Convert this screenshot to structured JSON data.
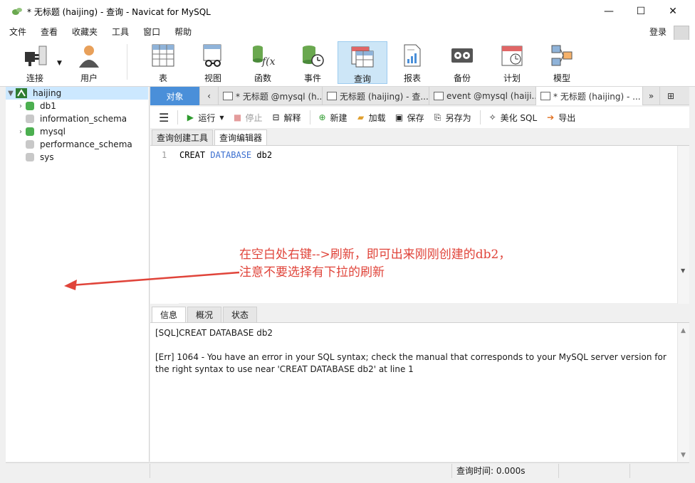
{
  "window": {
    "title": "* 无标题 (haijing) - 查询 - Navicat for MySQL",
    "controls": {
      "minimize": "—",
      "maximize": "☐",
      "close": "✕"
    }
  },
  "menubar": {
    "items": [
      "文件",
      "查看",
      "收藏夹",
      "工具",
      "窗口",
      "帮助"
    ],
    "login": "登录"
  },
  "toolbar": {
    "buttons": [
      {
        "label": "连接",
        "icon": "connection-icon"
      },
      {
        "label": "用户",
        "icon": "user-icon"
      },
      {
        "label": "表",
        "icon": "table-icon"
      },
      {
        "label": "视图",
        "icon": "view-icon"
      },
      {
        "label": "函数",
        "icon": "function-icon"
      },
      {
        "label": "事件",
        "icon": "event-icon"
      },
      {
        "label": "查询",
        "icon": "query-icon",
        "active": true
      },
      {
        "label": "报表",
        "icon": "report-icon"
      },
      {
        "label": "备份",
        "icon": "backup-icon"
      },
      {
        "label": "计划",
        "icon": "schedule-icon"
      },
      {
        "label": "模型",
        "icon": "model-icon"
      }
    ]
  },
  "navigator": {
    "connection": "haijing",
    "items": [
      {
        "label": "db1",
        "expandable": true,
        "color": "#4caf50"
      },
      {
        "label": "information_schema",
        "expandable": false,
        "color": "#c8c8c8"
      },
      {
        "label": "mysql",
        "expandable": true,
        "color": "#4caf50"
      },
      {
        "label": "performance_schema",
        "expandable": false,
        "color": "#c8c8c8"
      },
      {
        "label": "sys",
        "expandable": false,
        "color": "#c8c8c8"
      }
    ]
  },
  "tabs": {
    "objects": "对象",
    "items": [
      "* 无标题 @mysql (h...",
      "无标题 (haijing) - 查...",
      "event @mysql (haiji...",
      "* 无标题 (haijing) - ..."
    ]
  },
  "query_toolbar": {
    "run": "运行",
    "stop": "停止",
    "explain": "解释",
    "new": "新建",
    "load": "加载",
    "save": "保存",
    "save_as": "另存为",
    "beautify": "美化 SQL",
    "export": "导出"
  },
  "subtabs": {
    "builder": "查询创建工具",
    "editor": "查询编辑器"
  },
  "editor": {
    "line_number": "1",
    "code_part1": "CREAT ",
    "code_keyword": "DATABASE",
    "code_part2": " db2"
  },
  "annotation": {
    "line1": "在空白处右键-->刷新，即可出来刚刚创建的db2，",
    "line2": "注意不要选择有下拉的刷新",
    "color": "#e0443a"
  },
  "bottom_tabs": [
    "信息",
    "概况",
    "状态"
  ],
  "info": {
    "line1": "[SQL]CREAT DATABASE db2",
    "line2": "[Err] 1064 - You have an error in your SQL syntax; check the manual that corresponds to your MySQL server version for the right syntax to use near 'CREAT DATABASE db2' at line 1"
  },
  "status": {
    "query_time": "查询时间: 0.000s"
  }
}
